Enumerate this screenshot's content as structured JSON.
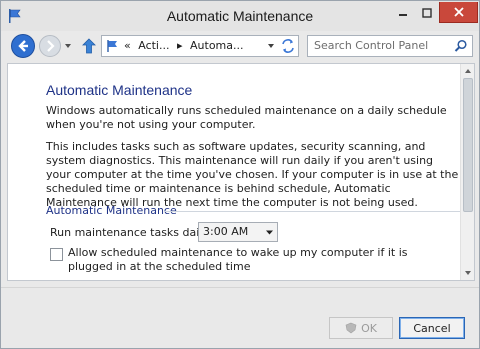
{
  "window": {
    "title": "Automatic Maintenance"
  },
  "nav": {
    "breadcrumbs": [
      "«",
      "Acti...",
      "▸",
      "Automa..."
    ],
    "search_placeholder": "Search Control Panel"
  },
  "content": {
    "title": "Automatic Maintenance",
    "intro": "Windows automatically runs scheduled maintenance on a daily schedule when you're not using your computer.",
    "details": "This includes tasks such as software updates, security scanning, and system diagnostics. This maintenance will run daily if you aren't using your computer at the time you've chosen. If your computer is in use at the scheduled time or maintenance is behind schedule, Automatic Maintenance will run the next time the computer is not being used.",
    "section_heading": "Automatic Maintenance",
    "run_label": "Run maintenance tasks daily at",
    "run_time": "3:00 AM",
    "wake_label": "Allow scheduled maintenance to wake up my computer if it is plugged in at the scheduled time",
    "wake_checked": false
  },
  "buttons": {
    "ok": "OK",
    "cancel": "Cancel"
  },
  "colors": {
    "accent": "#1e3287",
    "close": "#c9483b"
  }
}
